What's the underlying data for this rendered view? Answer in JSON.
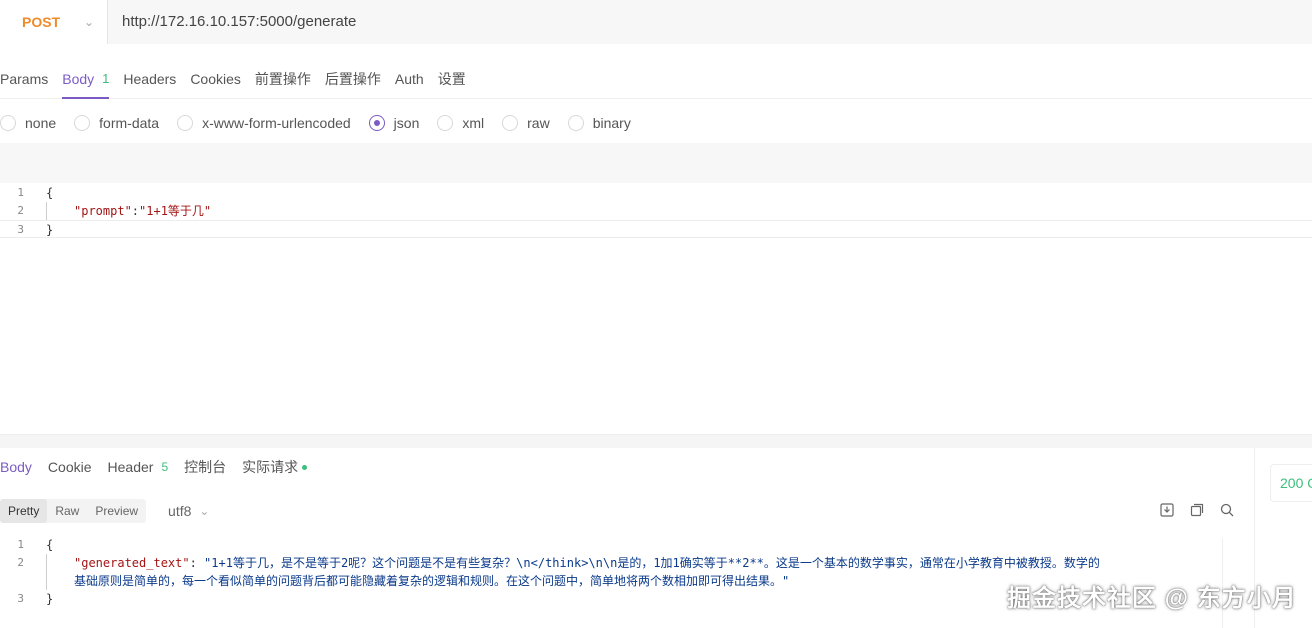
{
  "request": {
    "method": "POST",
    "url": "http://172.16.10.157:5000/generate"
  },
  "request_tabs": [
    {
      "label": "Params",
      "badge": ""
    },
    {
      "label": "Body",
      "badge": "1"
    },
    {
      "label": "Headers",
      "badge": ""
    },
    {
      "label": "Cookies",
      "badge": ""
    },
    {
      "label": "前置操作",
      "badge": ""
    },
    {
      "label": "后置操作",
      "badge": ""
    },
    {
      "label": "Auth",
      "badge": ""
    },
    {
      "label": "设置",
      "badge": ""
    }
  ],
  "body_types": [
    "none",
    "form-data",
    "x-www-form-urlencoded",
    "json",
    "xml",
    "raw",
    "binary"
  ],
  "body_type_selected": "json",
  "request_body": {
    "line_numbers": [
      "1",
      "2",
      "3"
    ],
    "open_brace": "{",
    "key": "\"prompt\"",
    "colon": ":",
    "value": "\"1+1等于几\"",
    "close_brace": "}"
  },
  "response_tabs": [
    {
      "label": "Body",
      "badge": ""
    },
    {
      "label": "Cookie",
      "badge": ""
    },
    {
      "label": "Header",
      "badge": "5"
    },
    {
      "label": "控制台",
      "badge": ""
    },
    {
      "label": "实际请求",
      "badge": ""
    }
  ],
  "format_buttons": [
    "Pretty",
    "Raw",
    "Preview"
  ],
  "encoding": "utf8",
  "status_text": "200 O",
  "response_body": {
    "line_numbers": [
      "1",
      "2",
      "3"
    ],
    "open_brace": "{",
    "key": "\"generated_text\"",
    "colon": ": ",
    "value_line1": "\"1+1等于几，是不是等于2呢？这个问题是不是有些复杂？\\n</think>\\n\\n是的，1加1确实等于**2**。这是一个基本的数学事实，通常在小学教育中被教授。数学的",
    "value_line2": "基础原则是简单的，每一个看似简单的问题背后都可能隐藏着复杂的逻辑和规则。在这个问题中，简单地将两个数相加即可得出结果。\"",
    "close_brace": "}"
  },
  "watermark": "掘金技术社区 @ 东方小月",
  "colors": {
    "accent": "#7c5cc4",
    "method": "#f08b2c",
    "success": "#3dbd7d"
  }
}
